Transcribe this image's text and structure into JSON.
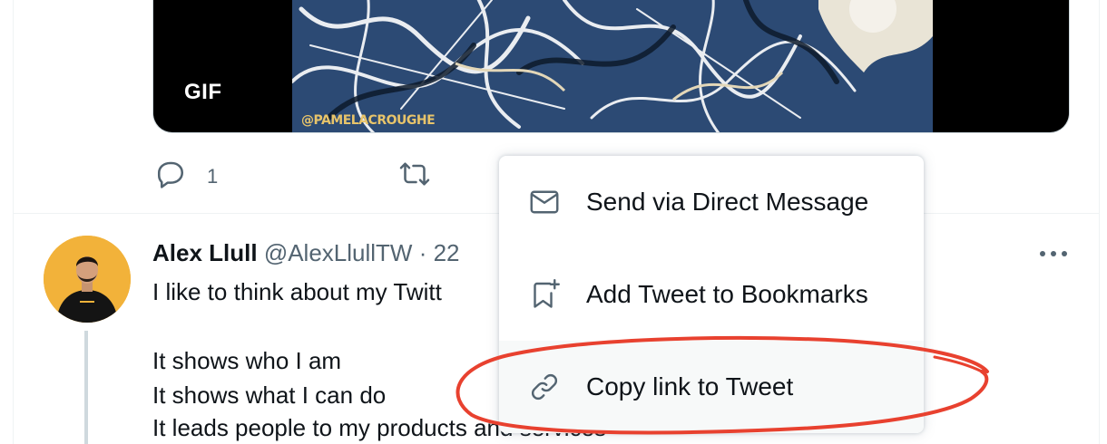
{
  "tweet_above": {
    "media": {
      "badge": "GIF",
      "watermark": "@PAMELACROUGHE"
    },
    "actions": {
      "reply_count": "1"
    }
  },
  "tweet": {
    "author_name": "Alex Llull",
    "author_handle": "@AlexLlullTW",
    "separator": " · ",
    "time": "22",
    "lines": [
      "I like to think about my Twitt",
      "It shows who I am",
      "It shows what I can do",
      "It leads people to my products and services"
    ]
  },
  "share_menu": {
    "items": [
      {
        "label": "Send via Direct Message",
        "icon": "envelope-icon"
      },
      {
        "label": "Add Tweet to Bookmarks",
        "icon": "bookmark-add-icon"
      },
      {
        "label": "Copy link to Tweet",
        "icon": "link-icon"
      }
    ]
  },
  "colors": {
    "text": "#0f1419",
    "secondary": "#536471",
    "annotation": "#e8412f",
    "avatar_bg": "#f2b23a",
    "menu_hover": "#f7f9f9"
  }
}
